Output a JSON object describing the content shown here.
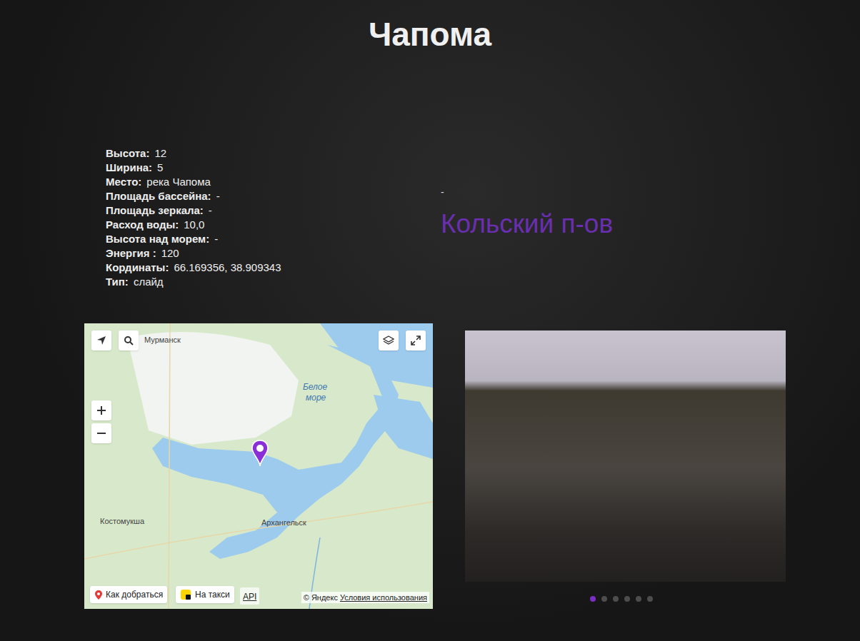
{
  "title": "Чапома",
  "properties": [
    {
      "label": "Высота:",
      "value": "12"
    },
    {
      "label": "Ширина:",
      "value": "5"
    },
    {
      "label": "Место:",
      "value": "река Чапома"
    },
    {
      "label": "Площадь бассейна:",
      "value": "-"
    },
    {
      "label": "Площадь зеркала:",
      "value": "-"
    },
    {
      "label": "Расход воды:",
      "value": "10,0"
    },
    {
      "label": "Высота над морем:",
      "value": "-"
    },
    {
      "label": "Энергия :",
      "value": "120"
    },
    {
      "label": "Кординаты:",
      "value": "66.169356, 38.909343"
    },
    {
      "label": "Тип:",
      "value": "слайд"
    }
  ],
  "note": "-",
  "region": "Кольский п-ов",
  "map": {
    "labels": [
      "Мурманск",
      "Белое",
      "море",
      "Костомукша",
      "Архангельск"
    ],
    "route_button": "Как добраться",
    "taxi_button": "На такси",
    "api_link": "API",
    "copyright": "© Яндекс",
    "terms": "Условия использования"
  },
  "gallery": {
    "dots": [
      {
        "selected": true
      },
      {
        "selected": false
      },
      {
        "selected": false
      },
      {
        "selected": false
      },
      {
        "selected": false
      },
      {
        "selected": false
      }
    ]
  }
}
